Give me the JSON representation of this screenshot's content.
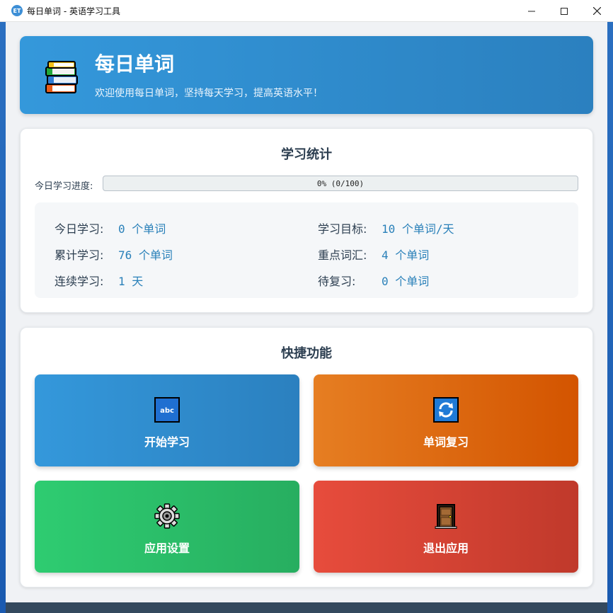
{
  "window": {
    "app_icon_text": "ET",
    "title": "每日单词 - 英语学习工具",
    "minimize_glyph": "—",
    "maximize_glyph": "☐",
    "close_glyph": "✕"
  },
  "banner": {
    "icon": "books-icon",
    "title": "每日单词",
    "subtitle": "欢迎使用每日单词，坚持每天学习，提高英语水平！"
  },
  "stats": {
    "heading": "学习统计",
    "progress_label": "今日学习进度:",
    "progress_text": "0% (0/100)",
    "progress_fraction": 0,
    "items": [
      {
        "label": "今日学习:",
        "value": "0 个单词"
      },
      {
        "label": "学习目标:",
        "value": "10 个单词/天"
      },
      {
        "label": "累计学习:",
        "value": "76 个单词"
      },
      {
        "label": "重点词汇:",
        "value": "4 个单词"
      },
      {
        "label": "连续学习:",
        "value": "1 天"
      },
      {
        "label": "待复习:",
        "value": "0 个单词"
      }
    ]
  },
  "quick": {
    "heading": "快捷功能",
    "tiles": [
      {
        "label": "开始学习",
        "icon": "abc-icon",
        "icon_text": "abc",
        "color": "#3498db"
      },
      {
        "label": "单词复习",
        "icon": "refresh-icon",
        "color": "#e67e22"
      },
      {
        "label": "应用设置",
        "icon": "gear-icon",
        "color": "#2ecc71"
      },
      {
        "label": "退出应用",
        "icon": "door-icon",
        "color": "#e74c3c"
      }
    ]
  },
  "colors": {
    "primary": "#3498db",
    "accent_text": "#2980b9",
    "heading_text": "#2c3e50",
    "footer": "#34495e"
  }
}
